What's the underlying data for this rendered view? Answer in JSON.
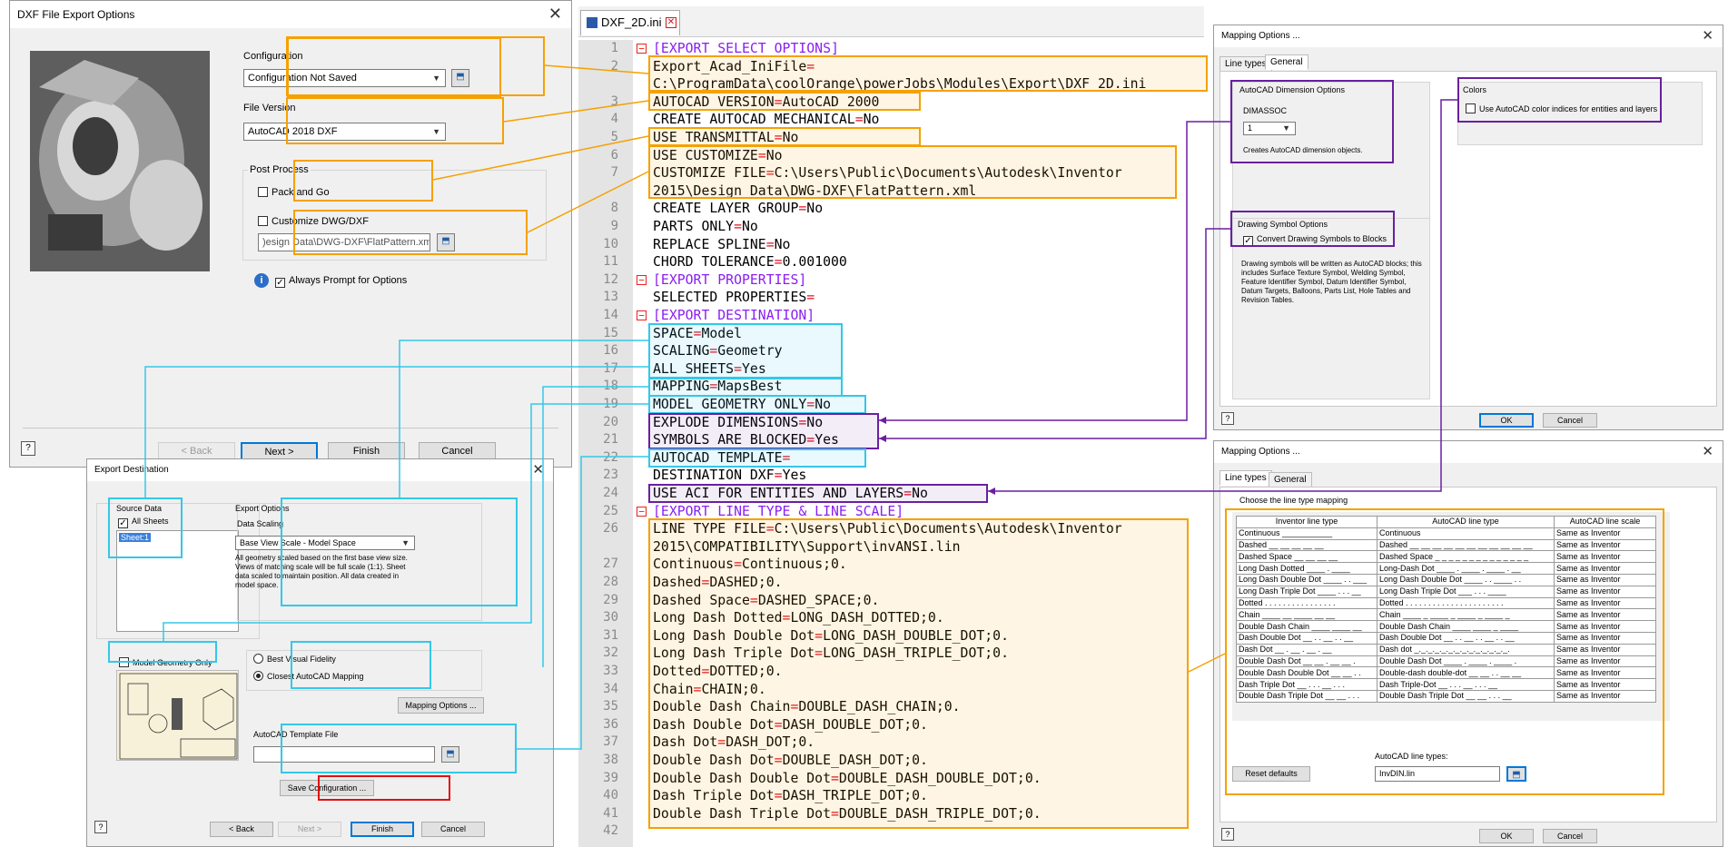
{
  "export_dialog": {
    "title": "DXF File Export Options",
    "configuration_label": "Configuration",
    "configuration_value": "Configuration Not Saved",
    "file_version_label": "File Version",
    "file_version_value": "AutoCAD 2018 DXF",
    "post_process_label": "Post Process",
    "pack_and_go": "Pack and Go",
    "customize_label": "Customize DWG/DXF",
    "customize_path": ")esign Data\\DWG-DXF\\FlatPattern.xml",
    "always_prompt": "Always Prompt for Options",
    "back": "< Back",
    "next": "Next >",
    "finish": "Finish",
    "cancel": "Cancel"
  },
  "destination_dialog": {
    "title": "Export Destination",
    "source_data": "Source Data",
    "all_sheets": "All Sheets",
    "sheet": "Sheet:1",
    "model_geometry_only": "Model Geometry Only",
    "export_options": "Export Options",
    "data_scaling": "Data Scaling",
    "scaling_value": "Base View Scale - Model Space",
    "scaling_desc": "All geometry scaled based on the first base view size. Views of matching scale will be full scale (1:1). Sheet data scaled to maintain position. All data created in model space.",
    "best_visual": "Best Visual Fidelity",
    "closest_mapping": "Closest AutoCAD Mapping",
    "mapping_options": "Mapping Options ...",
    "template_label": "AutoCAD Template File",
    "save_configuration": "Save Configuration ...",
    "back": "< Back",
    "next": "Next >",
    "finish": "Finish",
    "cancel": "Cancel"
  },
  "editor": {
    "tab": "DXF_2D.ini",
    "lines": [
      {
        "n": "1",
        "k": "section",
        "t": "[EXPORT SELECT OPTIONS]"
      },
      {
        "n": "2",
        "k": "kv",
        "key": "Export_Acad_IniFile",
        "val": ""
      },
      {
        "n": "",
        "k": "plain",
        "t": "C:\\ProgramData\\coolOrange\\powerJobs\\Modules\\Export\\DXF_2D.ini"
      },
      {
        "n": "3",
        "k": "kv",
        "key": "AUTOCAD VERSION",
        "val": "AutoCAD 2000"
      },
      {
        "n": "4",
        "k": "kv",
        "key": "CREATE AUTOCAD MECHANICAL",
        "val": "No"
      },
      {
        "n": "5",
        "k": "kv",
        "key": "USE TRANSMITTAL",
        "val": "No"
      },
      {
        "n": "6",
        "k": "kv",
        "key": "USE CUSTOMIZE",
        "val": "No"
      },
      {
        "n": "7",
        "k": "kv",
        "key": "CUSTOMIZE FILE",
        "val": "C:\\Users\\Public\\Documents\\Autodesk\\Inventor"
      },
      {
        "n": "",
        "k": "plain",
        "t": "2015\\Design Data\\DWG-DXF\\FlatPattern.xml"
      },
      {
        "n": "8",
        "k": "kv",
        "key": "CREATE LAYER GROUP",
        "val": "No"
      },
      {
        "n": "9",
        "k": "kv",
        "key": "PARTS ONLY",
        "val": "No"
      },
      {
        "n": "10",
        "k": "kv",
        "key": "REPLACE SPLINE",
        "val": "No"
      },
      {
        "n": "11",
        "k": "kv",
        "key": "CHORD TOLERANCE",
        "val": "0.001000"
      },
      {
        "n": "12",
        "k": "section",
        "t": "[EXPORT PROPERTIES]"
      },
      {
        "n": "13",
        "k": "kv",
        "key": "SELECTED PROPERTIES",
        "val": ""
      },
      {
        "n": "14",
        "k": "section",
        "t": "[EXPORT DESTINATION]"
      },
      {
        "n": "15",
        "k": "kv",
        "key": "SPACE",
        "val": "Model"
      },
      {
        "n": "16",
        "k": "kv",
        "key": "SCALING",
        "val": "Geometry"
      },
      {
        "n": "17",
        "k": "kv",
        "key": "ALL SHEETS",
        "val": "Yes"
      },
      {
        "n": "18",
        "k": "kv",
        "key": "MAPPING",
        "val": "MapsBest"
      },
      {
        "n": "19",
        "k": "kv",
        "key": "MODEL GEOMETRY ONLY",
        "val": "No"
      },
      {
        "n": "20",
        "k": "kv",
        "key": "EXPLODE DIMENSIONS",
        "val": "No"
      },
      {
        "n": "21",
        "k": "kv",
        "key": "SYMBOLS ARE BLOCKED",
        "val": "Yes"
      },
      {
        "n": "22",
        "k": "kv",
        "key": "AUTOCAD TEMPLATE",
        "val": ""
      },
      {
        "n": "23",
        "k": "kv",
        "key": "DESTINATION DXF",
        "val": "Yes"
      },
      {
        "n": "24",
        "k": "kv",
        "key": "USE ACI FOR ENTITIES AND LAYERS",
        "val": "No"
      },
      {
        "n": "25",
        "k": "section",
        "t": "[EXPORT LINE TYPE & LINE SCALE]"
      },
      {
        "n": "26",
        "k": "kv",
        "key": "LINE TYPE FILE",
        "val": "C:\\Users\\Public\\Documents\\Autodesk\\Inventor"
      },
      {
        "n": "",
        "k": "plain",
        "t": "2015\\COMPATIBILITY\\Support\\invANSI.lin"
      },
      {
        "n": "27",
        "k": "kv",
        "key": "Continuous",
        "val": "Continuous;0."
      },
      {
        "n": "28",
        "k": "kv",
        "key": "Dashed",
        "val": "DASHED;0."
      },
      {
        "n": "29",
        "k": "kv",
        "key": "Dashed Space",
        "val": "DASHED_SPACE;0."
      },
      {
        "n": "30",
        "k": "kv",
        "key": "Long Dash Dotted",
        "val": "LONG_DASH_DOTTED;0."
      },
      {
        "n": "31",
        "k": "kv",
        "key": "Long Dash Double Dot",
        "val": "LONG_DASH_DOUBLE_DOT;0."
      },
      {
        "n": "32",
        "k": "kv",
        "key": "Long Dash Triple Dot",
        "val": "LONG_DASH_TRIPLE_DOT;0."
      },
      {
        "n": "33",
        "k": "kv",
        "key": "Dotted",
        "val": "DOTTED;0."
      },
      {
        "n": "34",
        "k": "kv",
        "key": "Chain",
        "val": "CHAIN;0."
      },
      {
        "n": "35",
        "k": "kv",
        "key": "Double Dash Chain",
        "val": "DOUBLE_DASH_CHAIN;0."
      },
      {
        "n": "36",
        "k": "kv",
        "key": "Dash Double Dot",
        "val": "DASH_DOUBLE_DOT;0."
      },
      {
        "n": "37",
        "k": "kv",
        "key": "Dash Dot",
        "val": "DASH_DOT;0."
      },
      {
        "n": "38",
        "k": "kv",
        "key": "Double Dash Dot",
        "val": "DOUBLE_DASH_DOT;0."
      },
      {
        "n": "39",
        "k": "kv",
        "key": "Double Dash Double Dot",
        "val": "DOUBLE_DASH_DOUBLE_DOT;0."
      },
      {
        "n": "40",
        "k": "kv",
        "key": "Dash Triple Dot",
        "val": "DASH_TRIPLE_DOT;0."
      },
      {
        "n": "41",
        "k": "kv",
        "key": "Double Dash Triple Dot",
        "val": "DOUBLE_DASH_TRIPLE_DOT;0."
      },
      {
        "n": "42",
        "k": "plain",
        "t": ""
      }
    ]
  },
  "mapping_general": {
    "title": "Mapping Options ...",
    "tab_line_types": "Line types",
    "tab_general": "General",
    "dim_options": "AutoCAD Dimension Options",
    "dimassoc": "DIMASSOC",
    "dimassoc_value": "1",
    "dim_desc": "Creates AutoCAD dimension objects.",
    "symbol_options": "Drawing Symbol Options",
    "convert_symbols": "Convert Drawing Symbols to Blocks",
    "symbol_desc": "Drawing symbols will be written as AutoCAD blocks; this includes Surface Texture Symbol, Welding Symbol, Feature Identifier Symbol, Datum Identifier Symbol, Datum Targets, Balloons, Parts List, Hole Tables and Revision Tables.",
    "colors": "Colors",
    "use_aci": "Use AutoCAD color indices for entities and layers",
    "ok": "OK",
    "cancel": "Cancel"
  },
  "mapping_lines": {
    "title": "Mapping Options ...",
    "tab_line_types": "Line types",
    "tab_general": "General",
    "choose": "Choose the line type mapping",
    "headers": [
      "Inventor line type",
      "AutoCAD line type",
      "AutoCAD line scale"
    ],
    "rows": [
      [
        "Continuous ___________",
        "Continuous",
        "Same as Inventor"
      ],
      [
        "Dashed __ __ __ __ __",
        "Dashed __ __ __ __ __ __ __ __ __ __ __",
        "Same as Inventor"
      ],
      [
        "Dashed Space __ __ __ __",
        "Dashed Space _ _ _ _ _ _ _ _ _ _ _ _ _ _",
        "Same as Inventor"
      ],
      [
        "Long Dash Dotted ____ . ____",
        "Long-Dash Dot ____ . ____ . ____ . __",
        "Same as Inventor"
      ],
      [
        "Long Dash Double Dot ____ . . ___",
        "Long Dash Double Dot ____ . . ____ . .",
        "Same as Inventor"
      ],
      [
        "Long Dash Triple Dot ____ . . . __",
        "Long Dash Triple Dot ___ . . . ____",
        "Same as Inventor"
      ],
      [
        "Dotted . . . . . . . . . . . . . . . .",
        "Dotted . . . . . . . . . . . . . . . . . . . . . .",
        "Same as Inventor"
      ],
      [
        "Chain ____ __ ____ __ __",
        "Chain ____ _ ____ _ ____ _ ____ _",
        "Same as Inventor"
      ],
      [
        "Double Dash Chain ____ ____ __",
        "Double Dash Chain ____ ____ _ ____",
        "Same as Inventor"
      ],
      [
        "Dash Double Dot __ . . __ . . __",
        "Dash Double Dot __ . . __ . . __ . . __",
        "Same as Inventor"
      ],
      [
        "Dash Dot __ . __ . __ . __",
        "Dash dot _._._._._._._._._._._._._._.",
        "Same as Inventor"
      ],
      [
        "Double Dash Dot __ __ . __ __ .",
        "Double Dash Dot ____ . ____ . ____ .",
        "Same as Inventor"
      ],
      [
        "Double Dash Double Dot __ __ . .",
        "Double-dash double-dot __ __ . . __ __",
        "Same as Inventor"
      ],
      [
        "Dash Triple Dot __ . . . __ . . .",
        "Dash Triple-Dot __ . . . __ . . . __",
        "Same as Inventor"
      ],
      [
        "Double Dash Triple Dot __ __ . . .",
        "Double Dash Triple Dot __ __ . . . __",
        "Same as Inventor"
      ]
    ],
    "reset_defaults": "Reset defaults",
    "linetypes_label": "AutoCAD line types:",
    "linetypes_value": "InvDIN.lin",
    "ok": "OK",
    "cancel": "Cancel"
  },
  "colors": {
    "orange": "#f5a100",
    "cyan": "#33c8e8",
    "purple": "#6a1fa0",
    "red": "#e01010"
  }
}
